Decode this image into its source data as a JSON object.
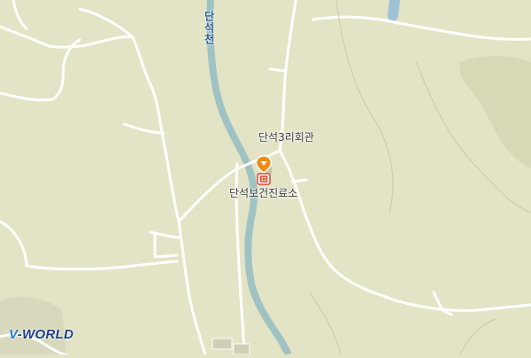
{
  "map": {
    "labels": {
      "stream": "단석천",
      "hall": "단석3리회관",
      "clinic": "단석보건진료소"
    },
    "logo": {
      "v": "V",
      "rest": "-WORLD"
    },
    "colors": {
      "land": "#e3e3c6",
      "forest_shade": "#d9d8b8",
      "road": "#ffffff",
      "water": "#9fc3c2",
      "pin": "#f08a1c"
    },
    "icons": [
      "location-pin-icon",
      "clinic-icon"
    ]
  }
}
